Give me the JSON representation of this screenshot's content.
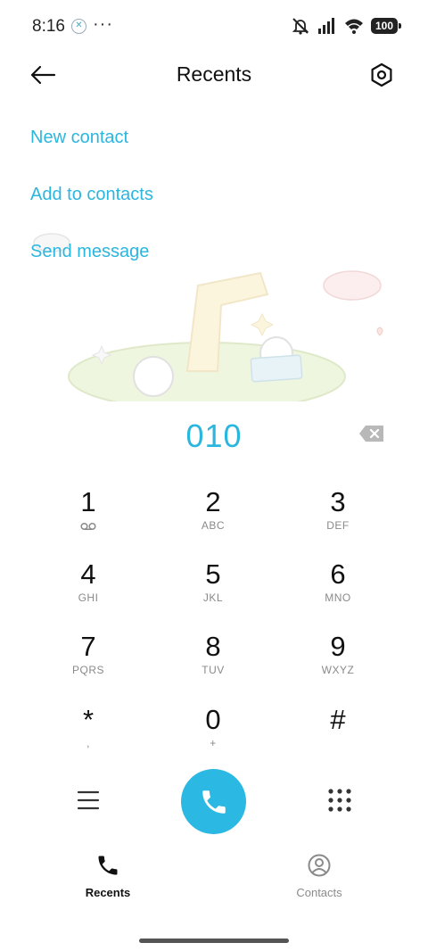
{
  "status_bar": {
    "time": "8:16",
    "more": "···",
    "battery": "100"
  },
  "header": {
    "title": "Recents"
  },
  "actions": {
    "new_contact": "New contact",
    "add_to_contacts": "Add to contacts",
    "send_message": "Send message"
  },
  "dialer": {
    "number": "010"
  },
  "keypad": [
    {
      "digit": "1",
      "letters": ""
    },
    {
      "digit": "2",
      "letters": "ABC"
    },
    {
      "digit": "3",
      "letters": "DEF"
    },
    {
      "digit": "4",
      "letters": "GHI"
    },
    {
      "digit": "5",
      "letters": "JKL"
    },
    {
      "digit": "6",
      "letters": "MNO"
    },
    {
      "digit": "7",
      "letters": "PQRS"
    },
    {
      "digit": "8",
      "letters": "TUV"
    },
    {
      "digit": "9",
      "letters": "WXYZ"
    },
    {
      "digit": "*",
      "letters": ","
    },
    {
      "digit": "0",
      "letters": "+"
    },
    {
      "digit": "#",
      "letters": ""
    }
  ],
  "nav": {
    "recents": "Recents",
    "contacts": "Contacts"
  },
  "colors": {
    "accent": "#2bb6de",
    "call_button": "#2bb8e3"
  }
}
